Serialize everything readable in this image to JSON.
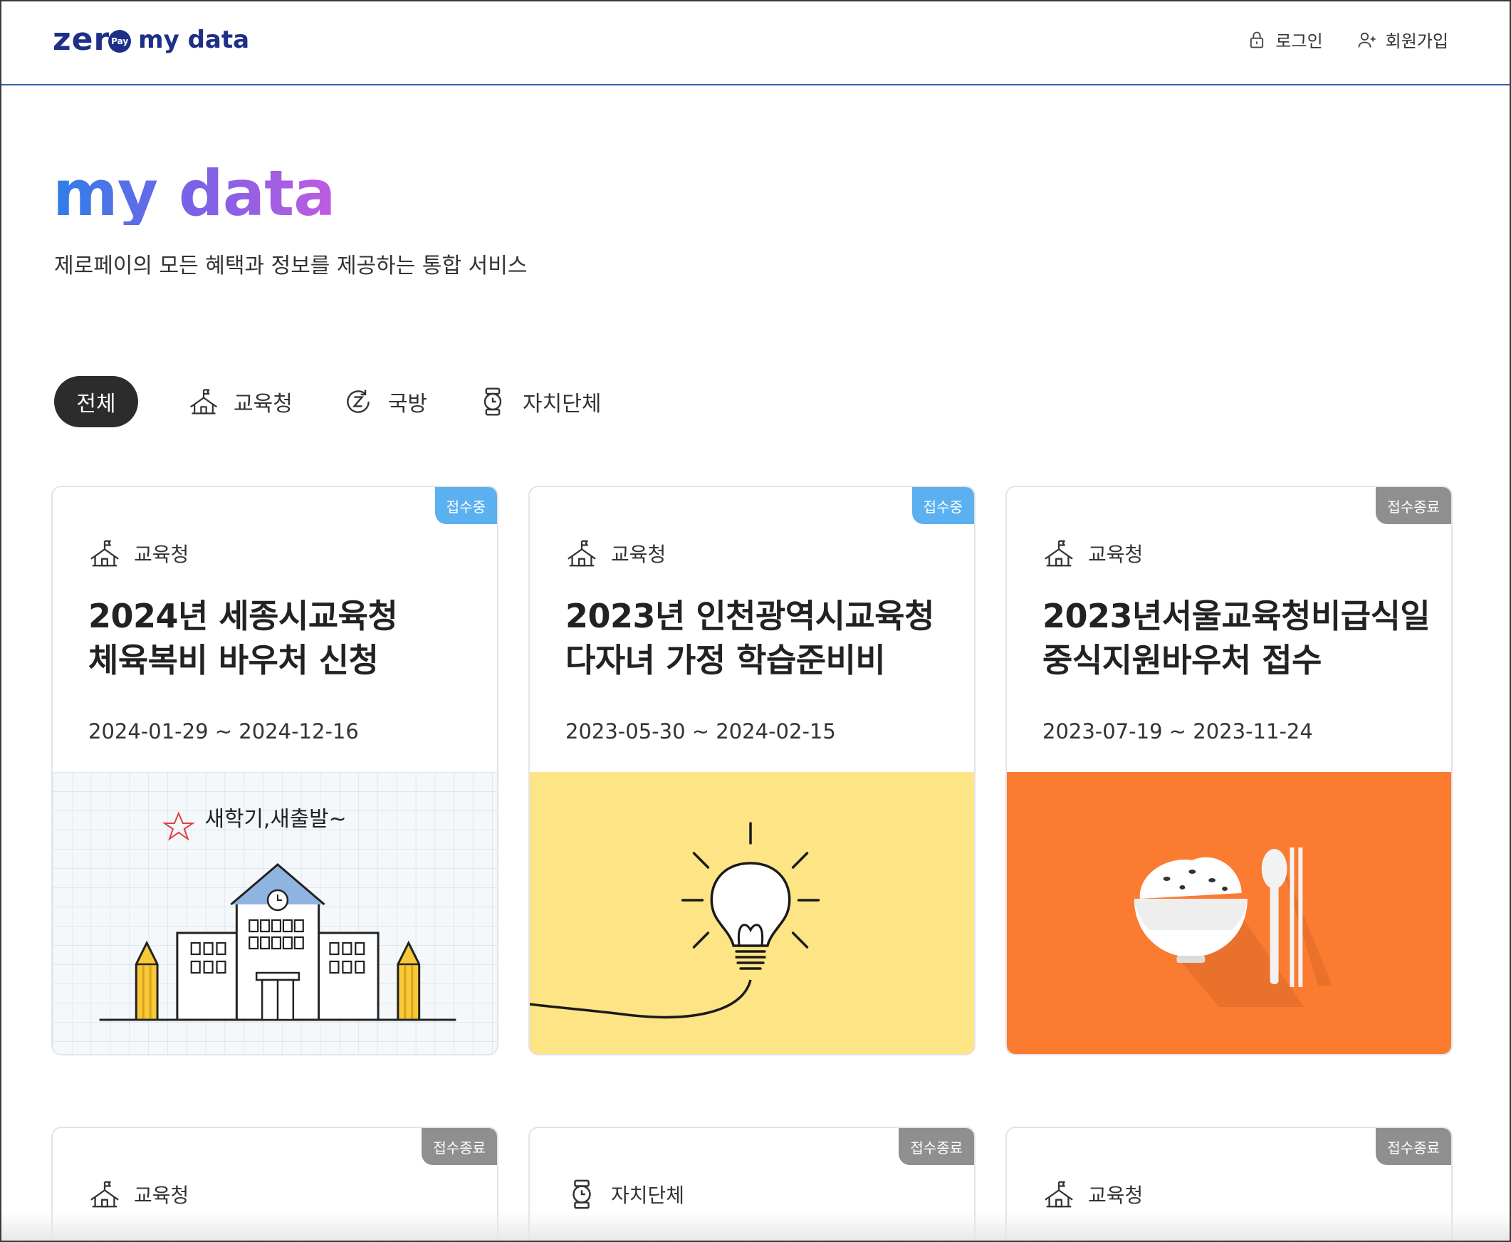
{
  "header": {
    "logo_zero": "zer",
    "logo_pay": "Pay",
    "logo_mydata": "my data",
    "login_label": "로그인",
    "signup_label": "회원가입"
  },
  "hero": {
    "title": "my data",
    "subtitle": "제로페이의 모든 혜택과 정보를 제공하는 통합 서비스"
  },
  "tabs": [
    {
      "label": "전체",
      "active": true
    },
    {
      "label": "교육청",
      "icon": "school-icon"
    },
    {
      "label": "국방",
      "icon": "military-icon"
    },
    {
      "label": "자치단체",
      "icon": "watch-icon"
    }
  ],
  "cards": [
    {
      "status": "접수중",
      "status_type": "open",
      "category": "교육청",
      "icon": "school-icon",
      "title_line1": "2024년 세종시교육청",
      "title_line2": "체육복비 바우처 신청",
      "date": "2024-01-29 ~ 2024-12-16",
      "image": "school-illustration",
      "image_text": "새학기,새출발~"
    },
    {
      "status": "접수중",
      "status_type": "open",
      "category": "교육청",
      "icon": "school-icon",
      "title_line1": "2023년 인천광역시교육청",
      "title_line2": "다자녀 가정 학습준비비",
      "date": "2023-05-30 ~ 2024-02-15",
      "image": "lightbulb-illustration"
    },
    {
      "status": "접수종료",
      "status_type": "closed",
      "category": "교육청",
      "icon": "school-icon",
      "title_line1": "2023년서울교육청비급식일",
      "title_line2": "중식지원바우처 접수",
      "date": "2023-07-19 ~ 2023-11-24",
      "image": "rice-bowl-illustration"
    },
    {
      "status": "접수종료",
      "status_type": "closed",
      "category": "교육청",
      "icon": "school-icon"
    },
    {
      "status": "접수종료",
      "status_type": "closed",
      "category": "자치단체",
      "icon": "watch-icon"
    },
    {
      "status": "접수종료",
      "status_type": "closed",
      "category": "교육청",
      "icon": "school-icon"
    }
  ],
  "colors": {
    "brand_navy": "#1d2f86",
    "open_badge": "#5bb0ef",
    "closed_badge": "#8f8f8f",
    "active_tab": "#2c2c2c"
  }
}
